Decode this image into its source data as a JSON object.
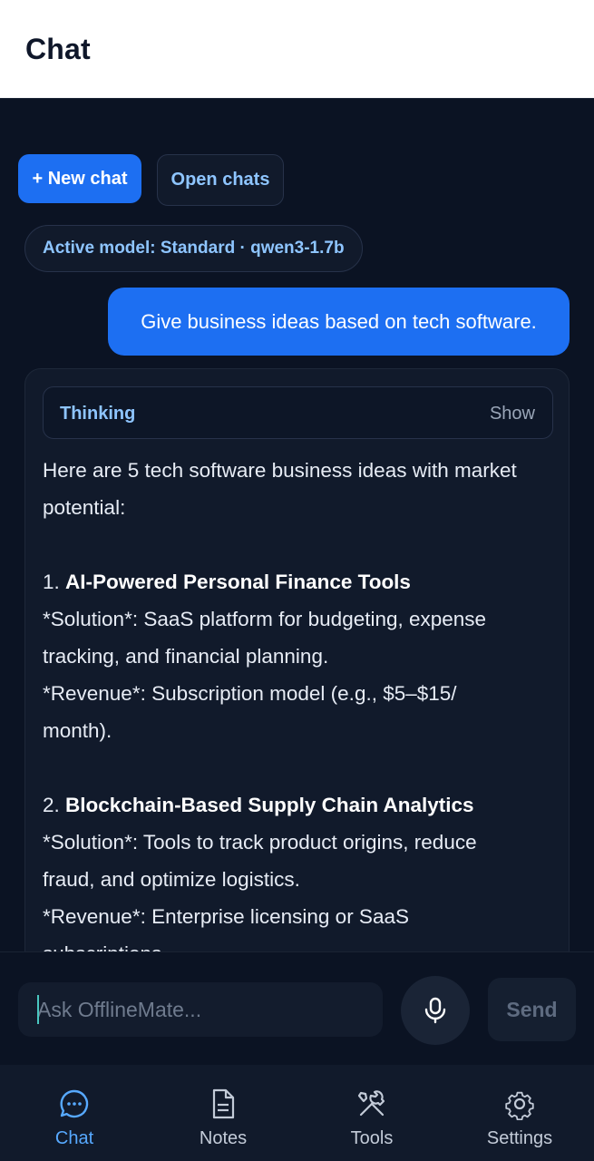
{
  "header": {
    "title": "Chat"
  },
  "actions": {
    "new_chat": "+ New chat",
    "open_chats": "Open chats"
  },
  "model_pill": "Active model: Standard · qwen3-1.7b",
  "user_message": "Give business ideas based on tech software.",
  "assistant": {
    "thinking_label": "Thinking",
    "thinking_toggle": "Show",
    "lines": [
      "Here are 5 tech software business ideas with market",
      "potential:",
      "",
      "1. ",
      "AI-Powered Personal Finance Tools",
      "*Solution*: SaaS platform for budgeting, expense",
      "tracking, and financial planning.",
      "*Revenue*: Subscription model (e.g., $5–$15/",
      "month).",
      "2. ",
      "Blockchain-Based Supply Chain Analytics",
      "*Solution*: Tools to track product origins, reduce",
      "fraud, and optimize logistics.",
      "*Revenue*: Enterprise licensing or SaaS",
      "subscriptions."
    ]
  },
  "composer": {
    "placeholder": "Ask OfflineMate...",
    "send_label": "Send",
    "mic_icon": "microphone-icon"
  },
  "nav": {
    "items": [
      {
        "label": "Chat",
        "icon": "chat-bubble-icon",
        "active": true
      },
      {
        "label": "Notes",
        "icon": "document-icon",
        "active": false
      },
      {
        "label": "Tools",
        "icon": "tools-icon",
        "active": false
      },
      {
        "label": "Settings",
        "icon": "gear-icon",
        "active": false
      }
    ]
  },
  "colors": {
    "accent": "#1d6ff2",
    "link": "#8ec5ff",
    "background": "#0b1323",
    "active_nav": "#57a9ff"
  }
}
